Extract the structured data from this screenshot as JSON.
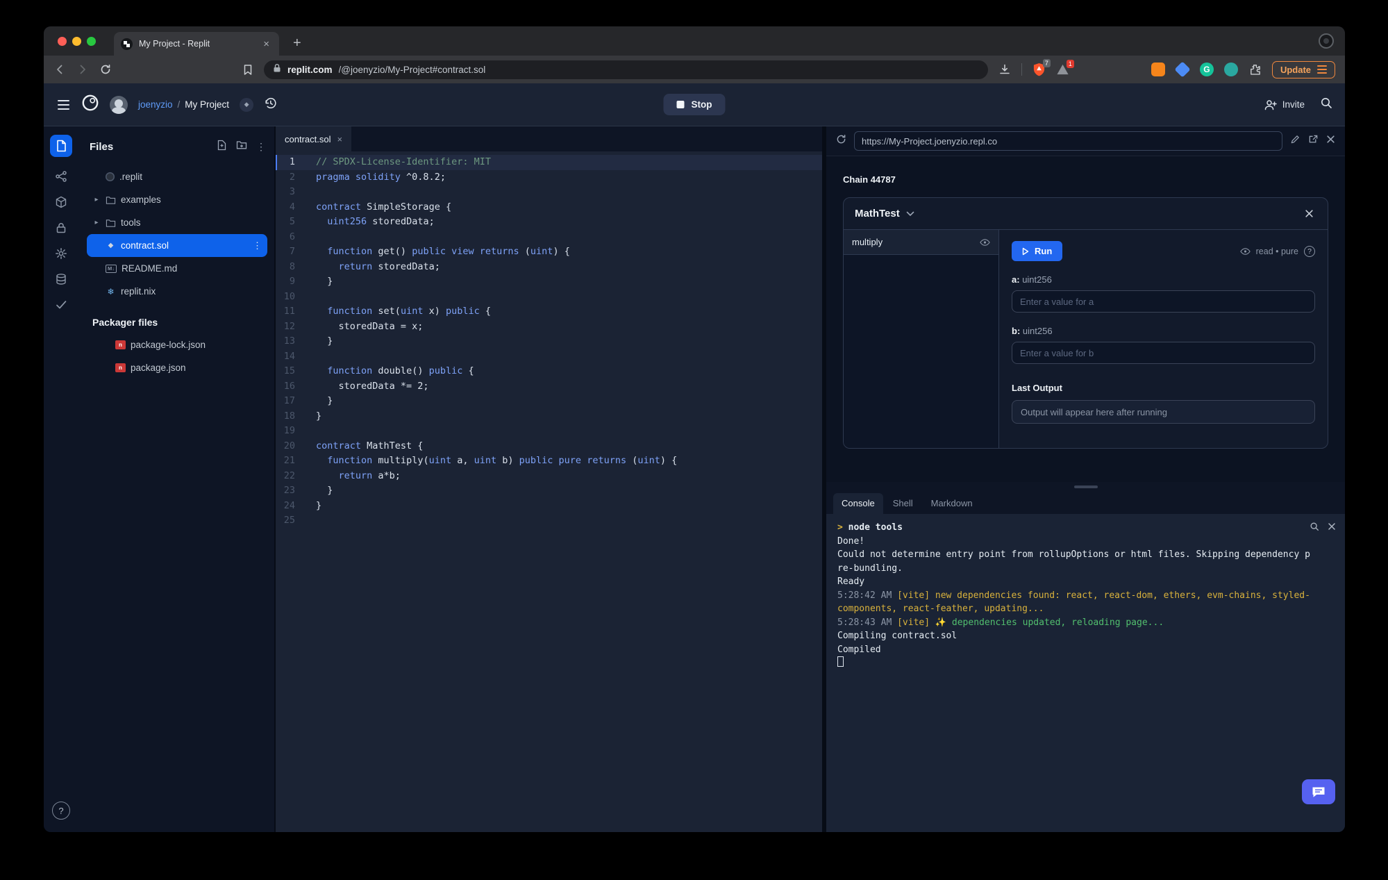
{
  "browser": {
    "tab_title": "My Project - Replit",
    "url_domain": "replit.com",
    "url_path": "/@joenyzio/My-Project#contract.sol",
    "shield_badge": "7",
    "alert_badge": "1",
    "update_label": "Update",
    "grammarly_letter": "G"
  },
  "app_header": {
    "username": "joenyzio",
    "breadcrumb_sep": "/",
    "project_name": "My Project",
    "stop_label": "Stop",
    "invite_label": "Invite"
  },
  "files_panel": {
    "title": "Files",
    "items": [
      {
        "label": ".replit",
        "icon": "replit-config-icon"
      },
      {
        "label": "examples",
        "icon": "folder-icon",
        "chevron": true
      },
      {
        "label": "tools",
        "icon": "folder-icon",
        "chevron": true
      },
      {
        "label": "contract.sol",
        "icon": "solidity-icon",
        "selected": true
      },
      {
        "label": "README.md",
        "icon": "markdown-icon"
      },
      {
        "label": "replit.nix",
        "icon": "nix-icon"
      }
    ],
    "packager_title": "Packager files",
    "packager_items": [
      {
        "label": "package-lock.json",
        "icon": "npm-icon"
      },
      {
        "label": "package.json",
        "icon": "npm-icon"
      }
    ],
    "help_label": "?"
  },
  "editor": {
    "tab_label": "contract.sol",
    "lines": [
      {
        "n": 1,
        "active": true,
        "t": [
          {
            "s": "// SPDX-License-Identifier: MIT",
            "c": "cm"
          }
        ]
      },
      {
        "n": 2,
        "t": [
          {
            "s": "pragma solidity",
            "c": "kw"
          },
          {
            "s": " ^0.8.2;",
            "c": "tx"
          }
        ]
      },
      {
        "n": 3,
        "t": []
      },
      {
        "n": 4,
        "t": [
          {
            "s": "contract",
            "c": "kw"
          },
          {
            "s": " SimpleStorage {",
            "c": "tx"
          }
        ]
      },
      {
        "n": 5,
        "t": [
          {
            "s": "  ",
            "c": "tx"
          },
          {
            "s": "uint256",
            "c": "kw"
          },
          {
            "s": " storedData;",
            "c": "tx"
          }
        ]
      },
      {
        "n": 6,
        "t": []
      },
      {
        "n": 7,
        "t": [
          {
            "s": "  ",
            "c": "tx"
          },
          {
            "s": "function",
            "c": "kw"
          },
          {
            "s": " get() ",
            "c": "tx"
          },
          {
            "s": "public view",
            "c": "kw"
          },
          {
            "s": " ",
            "c": "tx"
          },
          {
            "s": "returns",
            "c": "kw"
          },
          {
            "s": " (",
            "c": "tx"
          },
          {
            "s": "uint",
            "c": "kw"
          },
          {
            "s": ") {",
            "c": "tx"
          }
        ]
      },
      {
        "n": 8,
        "t": [
          {
            "s": "    ",
            "c": "tx"
          },
          {
            "s": "return",
            "c": "kw"
          },
          {
            "s": " storedData;",
            "c": "tx"
          }
        ]
      },
      {
        "n": 9,
        "t": [
          {
            "s": "  }",
            "c": "tx"
          }
        ]
      },
      {
        "n": 10,
        "t": []
      },
      {
        "n": 11,
        "t": [
          {
            "s": "  ",
            "c": "tx"
          },
          {
            "s": "function",
            "c": "kw"
          },
          {
            "s": " set(",
            "c": "tx"
          },
          {
            "s": "uint",
            "c": "kw"
          },
          {
            "s": " x) ",
            "c": "tx"
          },
          {
            "s": "public",
            "c": "kw"
          },
          {
            "s": " {",
            "c": "tx"
          }
        ]
      },
      {
        "n": 12,
        "t": [
          {
            "s": "    storedData = x;",
            "c": "tx"
          }
        ]
      },
      {
        "n": 13,
        "t": [
          {
            "s": "  }",
            "c": "tx"
          }
        ]
      },
      {
        "n": 14,
        "t": []
      },
      {
        "n": 15,
        "t": [
          {
            "s": "  ",
            "c": "tx"
          },
          {
            "s": "function",
            "c": "kw"
          },
          {
            "s": " double() ",
            "c": "tx"
          },
          {
            "s": "public",
            "c": "kw"
          },
          {
            "s": " {",
            "c": "tx"
          }
        ]
      },
      {
        "n": 16,
        "t": [
          {
            "s": "    storedData *= 2;",
            "c": "tx"
          }
        ]
      },
      {
        "n": 17,
        "t": [
          {
            "s": "  }",
            "c": "tx"
          }
        ]
      },
      {
        "n": 18,
        "t": [
          {
            "s": "}",
            "c": "tx"
          }
        ]
      },
      {
        "n": 19,
        "t": []
      },
      {
        "n": 20,
        "t": [
          {
            "s": "contract",
            "c": "kw"
          },
          {
            "s": " MathTest {",
            "c": "tx"
          }
        ]
      },
      {
        "n": 21,
        "t": [
          {
            "s": "  ",
            "c": "tx"
          },
          {
            "s": "function",
            "c": "kw"
          },
          {
            "s": " multiply(",
            "c": "tx"
          },
          {
            "s": "uint",
            "c": "kw"
          },
          {
            "s": " a, ",
            "c": "tx"
          },
          {
            "s": "uint",
            "c": "kw"
          },
          {
            "s": " b) ",
            "c": "tx"
          },
          {
            "s": "public pure",
            "c": "kw"
          },
          {
            "s": " ",
            "c": "tx"
          },
          {
            "s": "returns",
            "c": "kw"
          },
          {
            "s": " (",
            "c": "tx"
          },
          {
            "s": "uint",
            "c": "kw"
          },
          {
            "s": ") {",
            "c": "tx"
          }
        ]
      },
      {
        "n": 22,
        "t": [
          {
            "s": "    ",
            "c": "tx"
          },
          {
            "s": "return",
            "c": "kw"
          },
          {
            "s": " a*b;",
            "c": "tx"
          }
        ]
      },
      {
        "n": 23,
        "t": [
          {
            "s": "  }",
            "c": "tx"
          }
        ]
      },
      {
        "n": 24,
        "t": [
          {
            "s": "}",
            "c": "tx"
          }
        ]
      },
      {
        "n": 25,
        "t": []
      }
    ]
  },
  "webview": {
    "url": "https://My-Project.joenyzio.repl.co",
    "chain_label": "Chain 44787",
    "contract_name": "MathTest",
    "function_name": "multiply",
    "run_label": "Run",
    "modifiers": "read • pure",
    "help_label": "?",
    "field_a_label": "a:",
    "field_a_type": "uint256",
    "field_a_placeholder": "Enter a value for a",
    "field_b_label": "b:",
    "field_b_type": "uint256",
    "field_b_placeholder": "Enter a value for b",
    "last_output_label": "Last Output",
    "output_placeholder": "Output will appear here after running"
  },
  "console": {
    "tabs": [
      "Console",
      "Shell",
      "Markdown"
    ],
    "active_tab": "Console",
    "lines": [
      {
        "segs": [
          {
            "t": "> ",
            "c": "yel b"
          },
          {
            "t": "node tools",
            "c": "wht b"
          }
        ]
      },
      {
        "segs": [
          {
            "t": "Done!",
            "c": "wht"
          }
        ]
      },
      {
        "segs": [
          {
            "t": "Could not determine entry point from rollupOptions or html files. Skipping dependency pre-bundling.",
            "c": "wht"
          }
        ]
      },
      {
        "segs": [
          {
            "t": "Ready",
            "c": "wht"
          }
        ]
      },
      {
        "segs": [
          {
            "t": "5:28:42 AM ",
            "c": "gry"
          },
          {
            "t": "[vite] new dependencies found: react, react-dom, ethers, evm-chains, styled-components, react-feather, updating...",
            "c": "yel"
          }
        ]
      },
      {
        "segs": [
          {
            "t": "5:28:43 AM ",
            "c": "gry"
          },
          {
            "t": "[vite] ",
            "c": "yel"
          },
          {
            "t": "✨ dependencies updated, reloading page...",
            "c": "grn"
          }
        ]
      },
      {
        "segs": [
          {
            "t": "Compiling contract.sol",
            "c": "wht"
          }
        ]
      },
      {
        "segs": [
          {
            "t": "Compiled",
            "c": "wht"
          }
        ]
      },
      {
        "cursor": true,
        "segs": []
      }
    ]
  },
  "colors": {
    "accent_blue": "#0e62ea",
    "run_button_blue": "#2367f0",
    "brave_orange": "#fb542b",
    "update_orange": "#f0883e",
    "fab_indigo": "#5661f0",
    "console_yellow": "#d9b23c",
    "console_green": "#52bf6e",
    "selection_blue": "#0e62ea"
  }
}
